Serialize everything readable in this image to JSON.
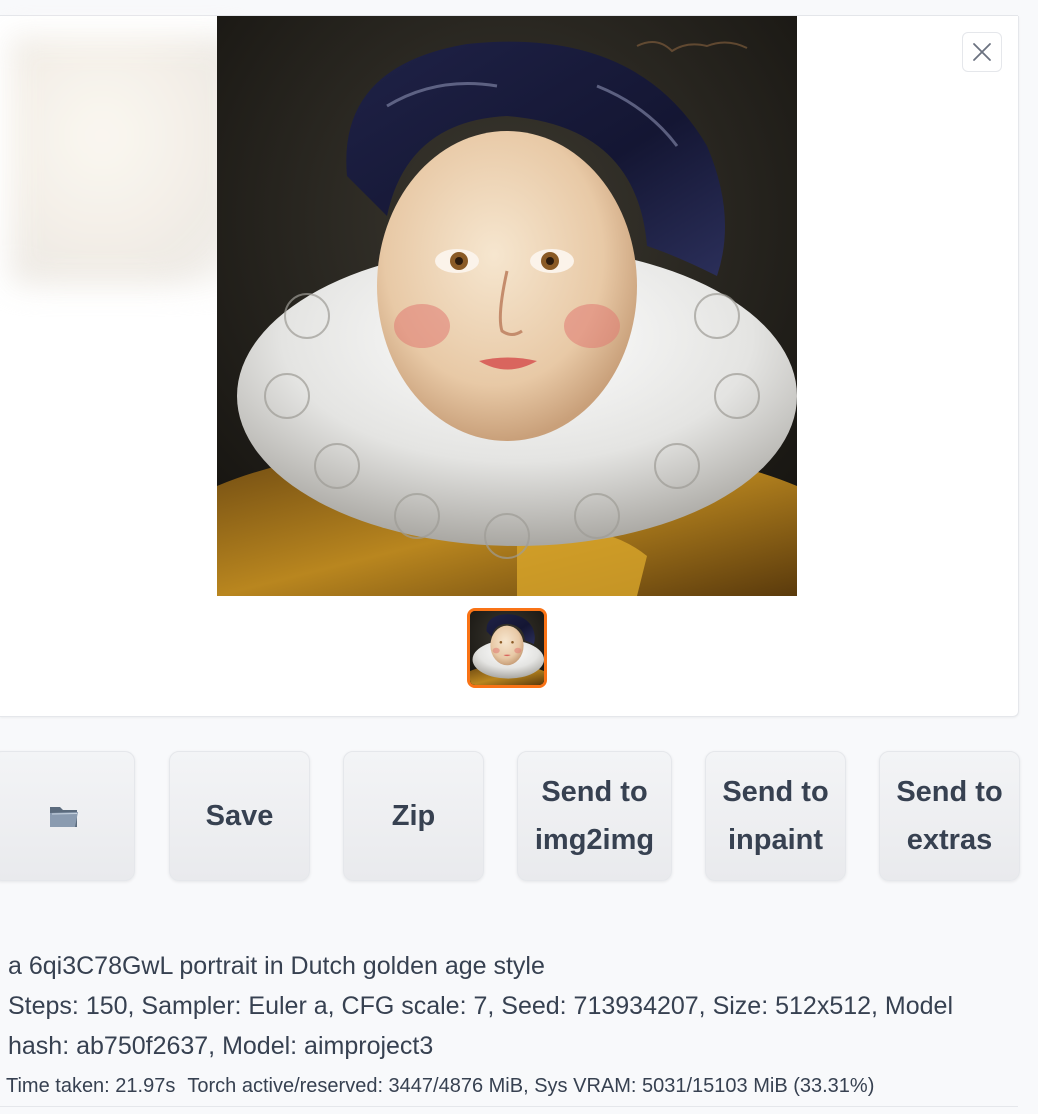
{
  "gallery": {
    "close_label": "Close"
  },
  "actions": {
    "open_folder_icon": "folder-icon",
    "save_label": "Save",
    "zip_label": "Zip",
    "send_img2img_label": "Send to\nimg2img",
    "send_inpaint_label": "Send to\ninpaint",
    "send_extras_label": "Send to\nextras"
  },
  "generation_info": {
    "prompt": "a 6qi3C78GwL portrait in Dutch golden age style",
    "parameters": "Steps: 150, Sampler: Euler a, CFG scale: 7, Seed: 713934207, Size: 512x512, Model hash: ab750f2637, Model: aimproject3"
  },
  "performance": {
    "time_taken": "Time taken: 21.97s",
    "torch_vram": "Torch active/reserved: 3447/4876 MiB, Sys VRAM: 5031/15103 MiB (33.31%)"
  },
  "colors": {
    "accent": "#f97316",
    "background": "#f8f9fb",
    "button_bg": "#f3f4f6",
    "text": "#374151"
  }
}
